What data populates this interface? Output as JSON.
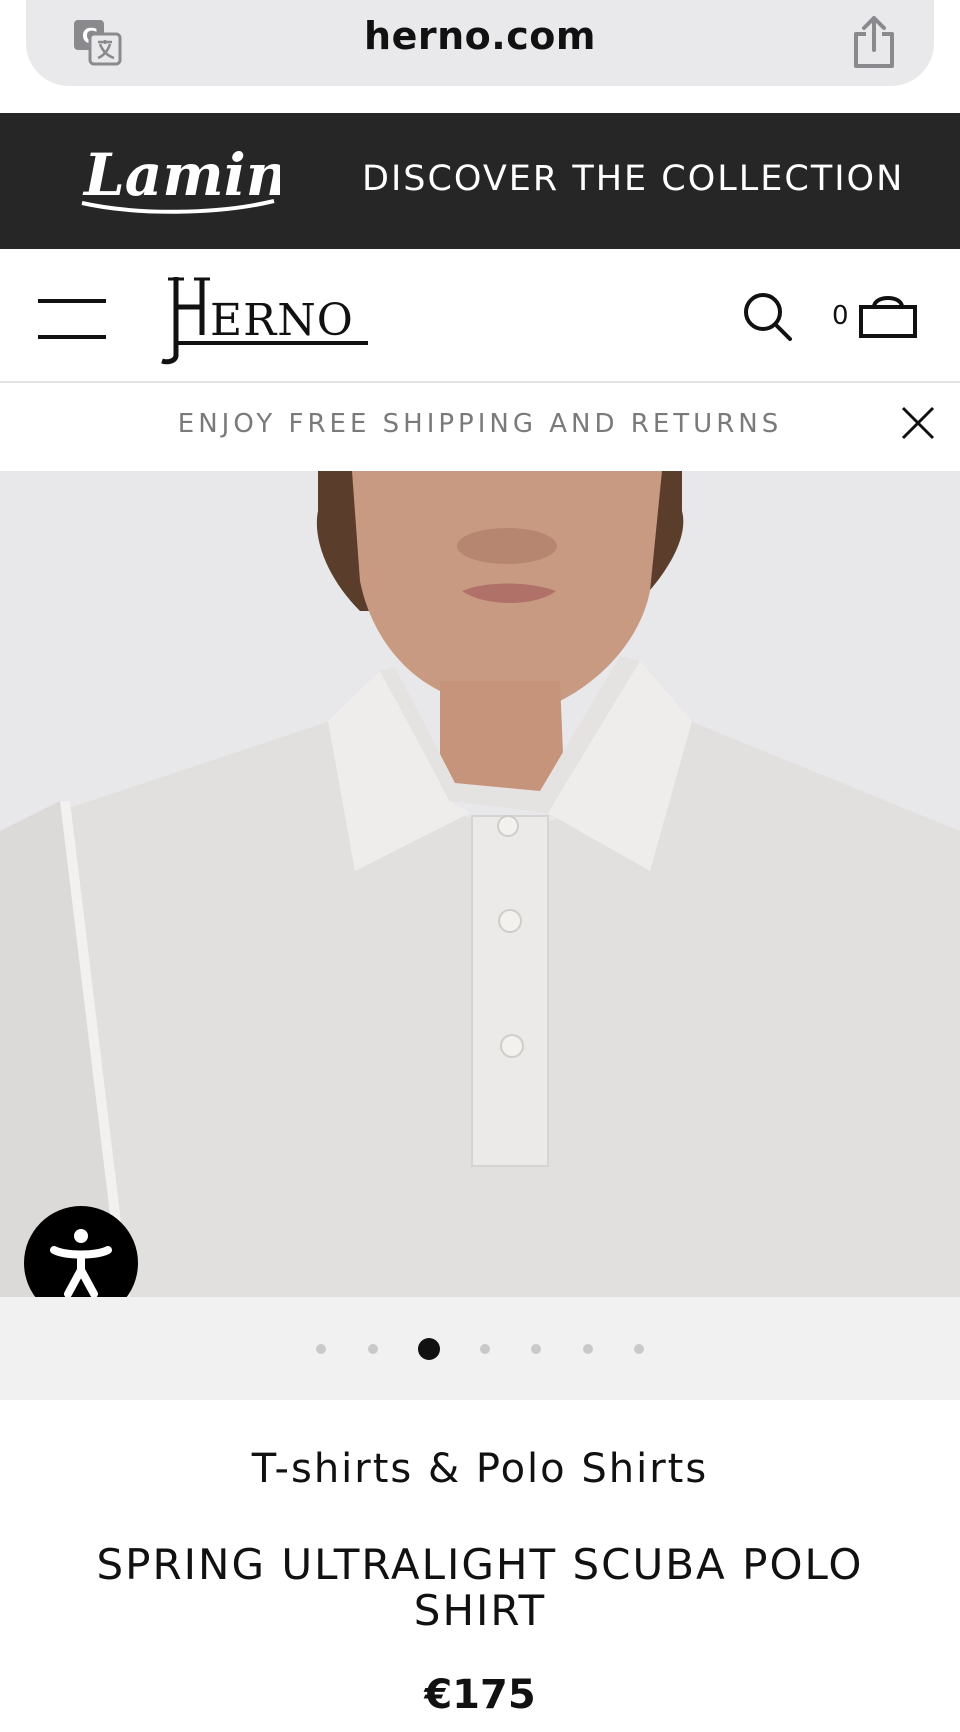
{
  "browser": {
    "url": "herno.com",
    "translate_icon": "translate-icon",
    "share_icon": "share-icon"
  },
  "promo": {
    "brand": "Laminar",
    "cta": "DISCOVER THE COLLECTION",
    "background": "#262626"
  },
  "header": {
    "menu_icon": "hamburger-menu-icon",
    "logo": "Herno",
    "search_icon": "search-icon",
    "cart_count": "0",
    "cart_icon": "shopping-bag-icon"
  },
  "shipping": {
    "text": "ENJOY FREE SHIPPING AND RETURNS",
    "close_icon": "close-icon"
  },
  "gallery": {
    "image": "white polo shirt on model",
    "total_slides": 7,
    "active_slide": 3,
    "accessibility_icon": "accessibility-icon"
  },
  "product": {
    "category": "T-shirts & Polo Shirts",
    "name": "SPRING ULTRALIGHT SCUBA POLO SHIRT",
    "price": "€175"
  }
}
